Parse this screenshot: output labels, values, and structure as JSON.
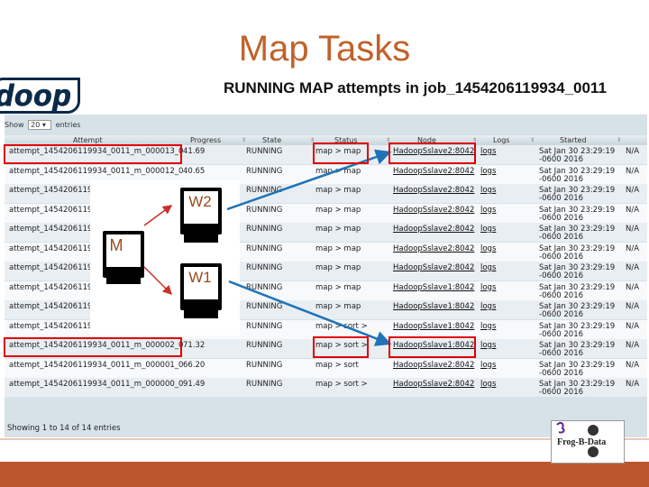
{
  "slide": {
    "title": "Map Tasks"
  },
  "logo": {
    "text": "doop"
  },
  "page": {
    "heading": "RUNNING MAP attempts in job_1454206119934_0011",
    "show_label": "Show",
    "show_value": "20",
    "entries_label": "entries",
    "footer": "Showing 1 to 14 of 14 entries"
  },
  "table": {
    "headers": [
      "Attempt",
      "Progress",
      "State",
      "Status",
      "Node",
      "Logs",
      "Started",
      ""
    ],
    "rows": [
      {
        "attempt": "attempt_1454206119934_0011_m_000013_0",
        "progress": "41.69",
        "state": "RUNNING",
        "status": "map > map",
        "node": "HadoopSslave2:8042",
        "logs": "logs",
        "started1": "Sat Jan 30 23:29:19",
        "started2": "-0600 2016",
        "na": "N/A"
      },
      {
        "attempt": "attempt_1454206119934_0011_m_000012_0",
        "progress": "40.65",
        "state": "RUNNING",
        "status": "map > map",
        "node": "HadoopSslave2:8042",
        "logs": "logs",
        "started1": "Sat Jan 30 23:29:19",
        "started2": "-0600 2016",
        "na": "N/A"
      },
      {
        "attempt": "attempt_1454206119934_0011_m_000011_0",
        "progress": "",
        "state": "RUNNING",
        "status": "map > map",
        "node": "HadoopSslave2:8042",
        "logs": "logs",
        "started1": "Sat Jan 30 23:29:19",
        "started2": "-0600 2016",
        "na": "N/A"
      },
      {
        "attempt": "attempt_1454206119934_0011_m_000010_0",
        "progress": "",
        "state": "RUNNING",
        "status": "map > map",
        "node": "HadoopSslave2:8042",
        "logs": "logs",
        "started1": "Sat Jan 30 23:29:19",
        "started2": "-0600 2016",
        "na": "N/A"
      },
      {
        "attempt": "attempt_1454206119934_0011_m_000009_0",
        "progress": "",
        "state": "RUNNING",
        "status": "map > map",
        "node": "HadoopSslave2:8042",
        "logs": "logs",
        "started1": "Sat Jan 30 23:29:19",
        "started2": "-0600 2016",
        "na": "N/A"
      },
      {
        "attempt": "attempt_1454206119934_0011_m_000008_0",
        "progress": "",
        "state": "RUNNING",
        "status": "map > map",
        "node": "HadoopSslave2:8042",
        "logs": "logs",
        "started1": "Sat Jan 30 23:29:19",
        "started2": "-0600 2016",
        "na": "N/A"
      },
      {
        "attempt": "attempt_1454206119934_0011_m_000007_0",
        "progress": "",
        "state": "RUNNING",
        "status": "map > map",
        "node": "HadoopSslave2:8042",
        "logs": "logs",
        "started1": "Sat Jan 30 23:29:19",
        "started2": "-0600 2016",
        "na": "N/A"
      },
      {
        "attempt": "attempt_1454206119934_0011_m_000006_0",
        "progress": "",
        "state": "RUNNING",
        "status": "map > map",
        "node": "HadoopSslave1:8042",
        "logs": "logs",
        "started1": "Sat Jan 30 23:29:19",
        "started2": "-0600 2016",
        "na": "N/A"
      },
      {
        "attempt": "attempt_1454206119934_0011_m_000005_0",
        "progress": "",
        "state": "RUNNING",
        "status": "map > map",
        "node": "HadoopSslave1:8042",
        "logs": "logs",
        "started1": "Sat Jan 30 23:29:19",
        "started2": "-0600 2016",
        "na": "N/A"
      },
      {
        "attempt": "attempt_1454206119934_0011_m_000003_0",
        "progress": "80.68",
        "state": "RUNNING",
        "status": "map > sort >",
        "node": "HadoopSslave1:8042",
        "logs": "logs",
        "started1": "Sat Jan 30 23:29:19",
        "started2": "-0600 2016",
        "na": "N/A"
      },
      {
        "attempt": "attempt_1454206119934_0011_m_000002_0",
        "progress": "71.32",
        "state": "RUNNING",
        "status": "map > sort >",
        "node": "HadoopSslave1:8042",
        "logs": "logs",
        "started1": "Sat Jan 30 23:29:19",
        "started2": "-0600 2016",
        "na": "N/A"
      },
      {
        "attempt": "attempt_1454206119934_0011_m_000001_0",
        "progress": "66.20",
        "state": "RUNNING",
        "status": "map > sort",
        "node": "HadoopSslave2:8042",
        "logs": "logs",
        "started1": "Sat Jan 30 23:29:19",
        "started2": "-0600 2016",
        "na": "N/A"
      },
      {
        "attempt": "attempt_1454206119934_0011_m_000000_0",
        "progress": "91.49",
        "state": "RUNNING",
        "status": "map > sort >",
        "node": "HadoopSslave2:8042",
        "logs": "logs",
        "started1": "Sat Jan 30 23:29:19",
        "started2": "-0600 2016",
        "na": "N/A"
      }
    ]
  },
  "diagram": {
    "master": "M",
    "worker2": "W2",
    "worker1": "W1"
  },
  "brand": {
    "text": "Frog-B-Data"
  },
  "colors": {
    "title": "#c0622b",
    "bottom_bar": "#bc562d",
    "highlight": "#e00000",
    "arrow": "#1f73b7"
  }
}
